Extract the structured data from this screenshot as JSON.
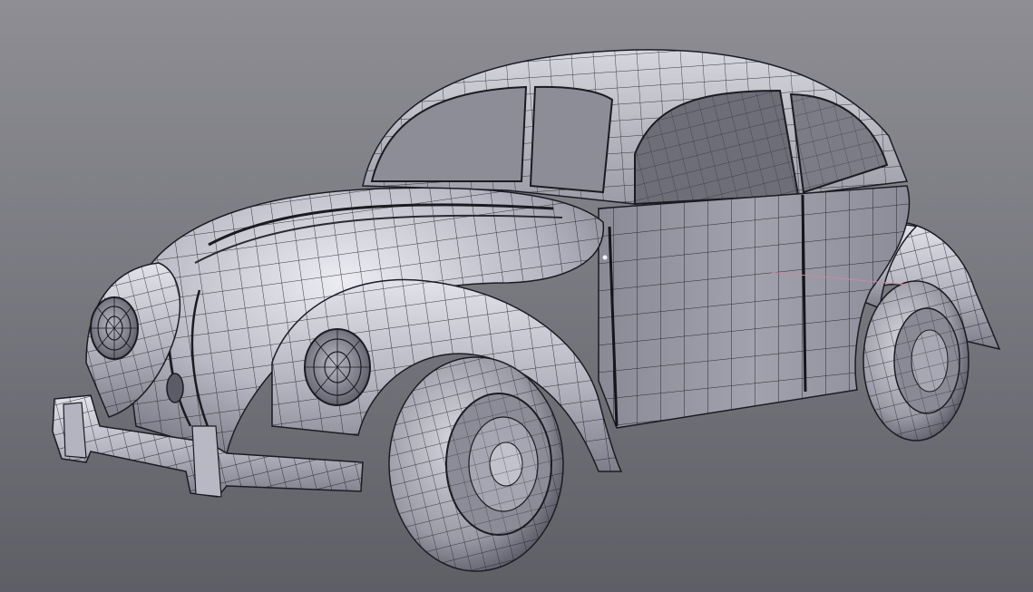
{
  "viewport": {
    "shading": "solid-wireframe",
    "colors": {
      "background_top": "#8e8e94",
      "background_bottom": "#5e5e65",
      "surface_light": "#dcdce4",
      "surface_mid": "#a9a9b4",
      "surface_dark": "#63636e",
      "wire": "#1b1b22",
      "selection_edge": "#c98aa0"
    }
  }
}
